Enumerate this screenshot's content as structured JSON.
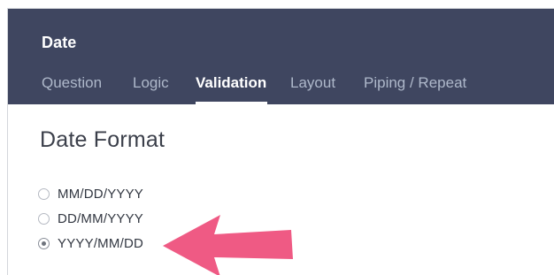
{
  "header": {
    "title": "Date",
    "tabs": [
      {
        "label": "Question",
        "active": false
      },
      {
        "label": "Logic",
        "active": false
      },
      {
        "label": "Validation",
        "active": true
      },
      {
        "label": "Layout",
        "active": false
      },
      {
        "label": "Piping / Repeat",
        "active": false
      }
    ]
  },
  "section": {
    "title": "Date Format",
    "options": [
      {
        "label": "MM/DD/YYYY",
        "selected": false
      },
      {
        "label": "DD/MM/YYYY",
        "selected": false
      },
      {
        "label": "YYYY/MM/DD",
        "selected": true
      }
    ]
  },
  "annotation": {
    "icon": "arrow-left-icon",
    "color": "#ef5a84"
  },
  "colors": {
    "header_bg": "#3f4660",
    "tab_inactive": "#aeb8ca",
    "tab_active": "#ffffff"
  }
}
